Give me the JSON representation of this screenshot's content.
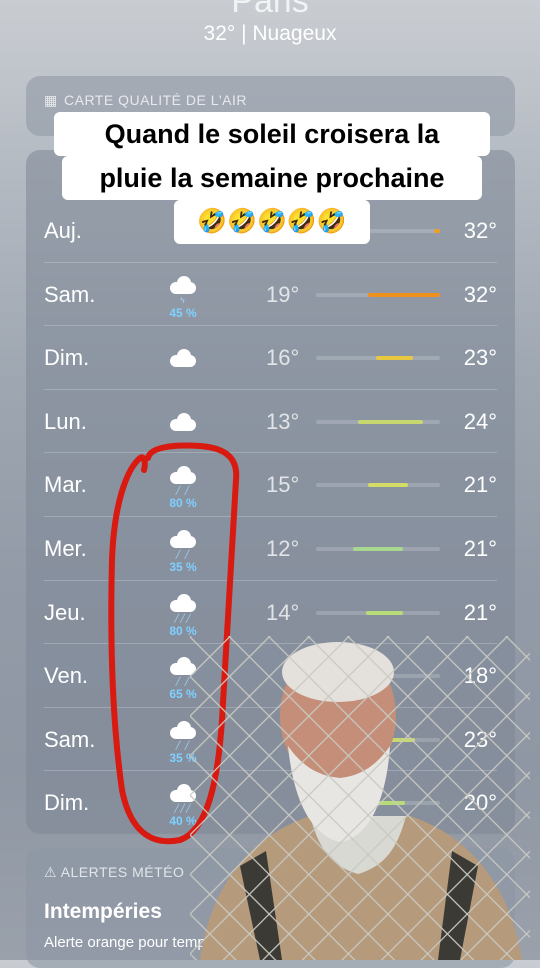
{
  "header": {
    "city": "Paris",
    "condition": "32°  |  Nuageux"
  },
  "air_quality": {
    "label": "CARTE QUALITÉ DE L'AIR"
  },
  "caption": {
    "line1": "Quand le soleil croisera la",
    "line2": "pluie la semaine prochaine",
    "emojis": "🤣🤣🤣🤣🤣"
  },
  "forecast": [
    {
      "day": "Auj.",
      "icon": "sun-icon",
      "rain": "",
      "low": "",
      "high": "32°",
      "range": [
        0.95,
        1.0
      ],
      "color": "#f0a020"
    },
    {
      "day": "Sam.",
      "icon": "thunderstorm-icon",
      "rain": "45 %",
      "low": "19°",
      "high": "32°",
      "range": [
        0.42,
        1.0
      ],
      "color": "#f0901c"
    },
    {
      "day": "Dim.",
      "icon": "cloud-icon",
      "rain": "",
      "low": "16°",
      "high": "23°",
      "range": [
        0.48,
        0.78
      ],
      "color": "#e8c840"
    },
    {
      "day": "Lun.",
      "icon": "cloud-icon",
      "rain": "",
      "low": "13°",
      "high": "24°",
      "range": [
        0.34,
        0.86
      ],
      "color": "#c8d870"
    },
    {
      "day": "Mar.",
      "icon": "rain-icon",
      "rain": "80 %",
      "low": "15°",
      "high": "21°",
      "range": [
        0.42,
        0.74
      ],
      "color": "#d4dc68"
    },
    {
      "day": "Mer.",
      "icon": "rain-icon",
      "rain": "35 %",
      "low": "12°",
      "high": "21°",
      "range": [
        0.3,
        0.7
      ],
      "color": "#a8d890"
    },
    {
      "day": "Jeu.",
      "icon": "heavy-rain-icon",
      "rain": "80 %",
      "low": "14°",
      "high": "21°",
      "range": [
        0.4,
        0.7
      ],
      "color": "#b8dc78"
    },
    {
      "day": "Ven.",
      "icon": "rain-icon",
      "rain": "65 %",
      "low": "",
      "high": "18°",
      "range": [
        0.35,
        0.6
      ],
      "color": "#a8d890"
    },
    {
      "day": "Sam.",
      "icon": "rain-icon",
      "rain": "35 %",
      "low": "",
      "high": "23°",
      "range": [
        0.4,
        0.8
      ],
      "color": "#c8d870"
    },
    {
      "day": "Dim.",
      "icon": "heavy-rain-icon",
      "rain": "40 %",
      "low": "",
      "high": "20°",
      "range": [
        0.4,
        0.72
      ],
      "color": "#b8dc78"
    }
  ],
  "alerts": {
    "label": "ALERTES MÉTÉO",
    "title": "Intempéries",
    "text": "Alerte orange pour température élevée. Ces"
  }
}
